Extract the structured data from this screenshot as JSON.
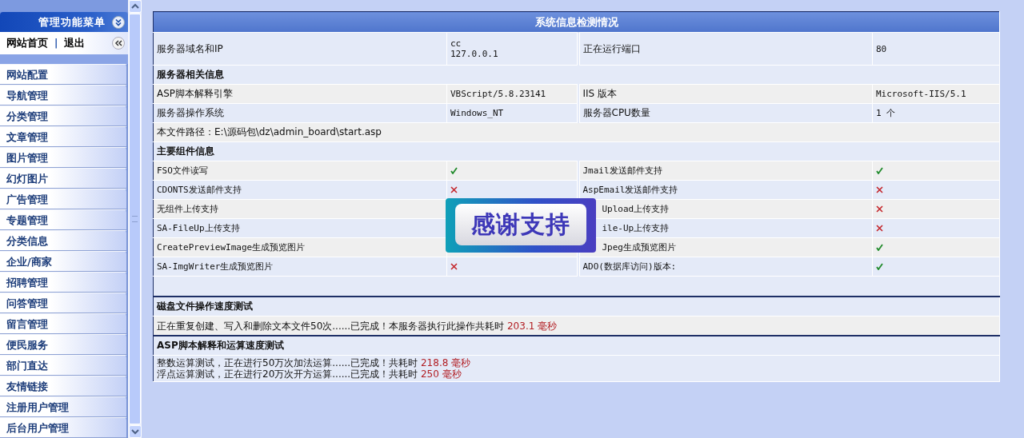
{
  "sidebar": {
    "title": "管理功能菜单",
    "home_link": "网站首页",
    "separator": "|",
    "logout_link": "退出",
    "items": [
      {
        "label": "网站配置"
      },
      {
        "label": "导航管理"
      },
      {
        "label": "分类管理"
      },
      {
        "label": "文章管理"
      },
      {
        "label": "图片管理"
      },
      {
        "label": "幻灯图片"
      },
      {
        "label": "广告管理"
      },
      {
        "label": "专题管理"
      },
      {
        "label": "分类信息"
      },
      {
        "label": "企业/商家"
      },
      {
        "label": "招聘管理"
      },
      {
        "label": "问答管理"
      },
      {
        "label": "留言管理"
      },
      {
        "label": "便民服务"
      },
      {
        "label": "部门直达"
      },
      {
        "label": "友情链接"
      },
      {
        "label": "注册用户管理"
      },
      {
        "label": "后台用户管理"
      }
    ]
  },
  "table": {
    "title": "系统信息检测情况",
    "host": {
      "label": "服务器域名和IP",
      "name": "cc",
      "ip": "127.0.0.1",
      "port_label": "正在运行端口",
      "port": "80"
    },
    "server_section": "服务器相关信息",
    "server_rows": [
      {
        "label": "ASP脚本解释引擎",
        "value": "VBScript/5.8.23141",
        "label2": "IIS 版本",
        "value2": "Microsoft-IIS/5.1"
      },
      {
        "label": "服务器操作系统",
        "value": "Windows_NT",
        "label2": "服务器CPU数量",
        "value2": "1 个"
      }
    ],
    "file_path": "本文件路径：E:\\源码包\\dz\\admin_board\\start.asp",
    "components_section": "主要组件信息",
    "component_rows": [
      {
        "label": "FSO文件读写",
        "supported": true,
        "label2": "Jmail发送邮件支持",
        "supported2": true
      },
      {
        "label": "CDONTS发送邮件支持",
        "supported": false,
        "label2": "AspEmail发送邮件支持",
        "supported2": false
      },
      {
        "label": "无组件上传支持",
        "label2": "Upload上传支持",
        "supported2": false
      },
      {
        "label": "SA-FileUp上传支持",
        "label2": "ile-Up上传支持",
        "supported2": false
      },
      {
        "label": "CreatePreviewImage生成预览图片",
        "label2": "Jpeg生成预览图片",
        "supported2": true
      },
      {
        "label": "SA-ImgWriter生成预览图片",
        "supported": false,
        "label2": "ADO(数据库访问)版本:",
        "supported2": true
      }
    ],
    "overlay": {
      "text": "感谢支持"
    },
    "disk_test": {
      "title": "磁盘文件操作速度测试",
      "lines": [
        {
          "text": "正在重复创建、写入和删除文本文件50次......已完成！本服务器执行此操作共耗时",
          "time": "203.1 毫秒"
        }
      ]
    },
    "asp_test": {
      "title": "ASP脚本解释和运算速度测试",
      "lines": [
        {
          "text": "整数运算测试，正在进行50万次加法运算......已完成！共耗时",
          "time": "218.8 毫秒"
        },
        {
          "text": "浮点运算测试，正在进行20万次开方运算......已完成！共耗时",
          "time": "250 毫秒"
        }
      ]
    }
  }
}
